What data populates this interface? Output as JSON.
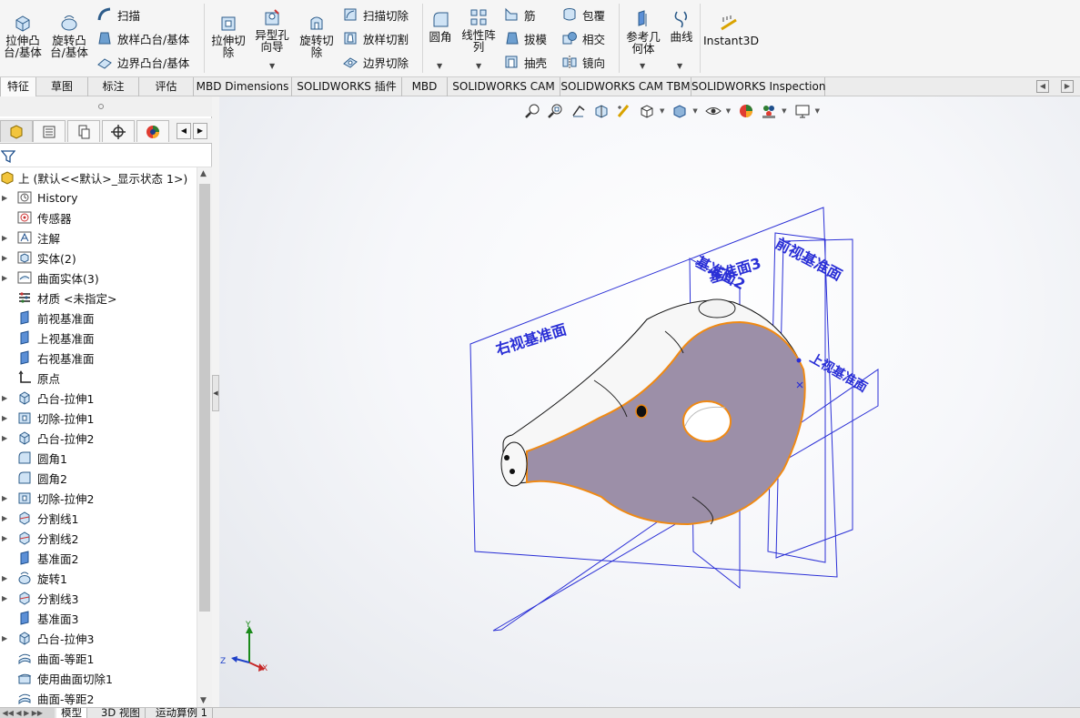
{
  "ribbon": {
    "extrude_boss": "拉伸凸\n台/基体",
    "revolve_boss": "旋转凸\n台/基体",
    "sweep": "扫描",
    "loft": "放样凸台/基体",
    "boundary": "边界凸台/基体",
    "extrude_cut": "拉伸切\n除",
    "hole_wizard": "异型孔\n向导",
    "revolve_cut": "旋转切\n除",
    "swept_cut": "扫描切除",
    "lofted_cut": "放样切割",
    "boundary_cut": "边界切除",
    "fillet": "圆角",
    "linear_pattern": "线性阵\n列",
    "rib": "筋",
    "draft": "拔模",
    "shell": "抽壳",
    "wrap": "包覆",
    "intersect": "相交",
    "mirror": "镜向",
    "ref_geometry": "参考几\n何体",
    "curves": "曲线",
    "instant3d": "Instant3D"
  },
  "tabs": [
    "特征",
    "草图",
    "标注",
    "评估",
    "MBD Dimensions",
    "SOLIDWORKS 插件",
    "MBD",
    "SOLIDWORKS CAM",
    "SOLIDWORKS CAM TBM",
    "SOLIDWORKS Inspection"
  ],
  "tree": {
    "root": "上  (默认<<默认>_显示状态 1>)",
    "items": [
      "History",
      "传感器",
      "注解",
      "实体(2)",
      "曲面实体(3)",
      "材质 <未指定>",
      "前视基准面",
      "上视基准面",
      "右视基准面",
      "原点",
      "凸台-拉伸1",
      "切除-拉伸1",
      "凸台-拉伸2",
      "圆角1",
      "圆角2",
      "切除-拉伸2",
      "分割线1",
      "分割线2",
      "基准面2",
      "旋转1",
      "分割线3",
      "基准面3",
      "凸台-拉伸3",
      "曲面-等距1",
      "使用曲面切除1",
      "曲面-等距2"
    ]
  },
  "bottom_tabs": [
    "模型",
    "3D 视图",
    "运动算例 1"
  ],
  "viewport": {
    "plane_labels": {
      "right": "右视基准面",
      "front": "前视基准面",
      "plane3": "基准面3",
      "plane2": "基准面2",
      "top": "上视基准面"
    },
    "triad": {
      "x": "X",
      "y": "Y",
      "z": "Z"
    }
  },
  "colors": {
    "plane_blue": "#2a2fd6",
    "face_purple": "#9c8fa8",
    "edge_orange": "#f08a14",
    "tab_active": "#fafafa"
  }
}
